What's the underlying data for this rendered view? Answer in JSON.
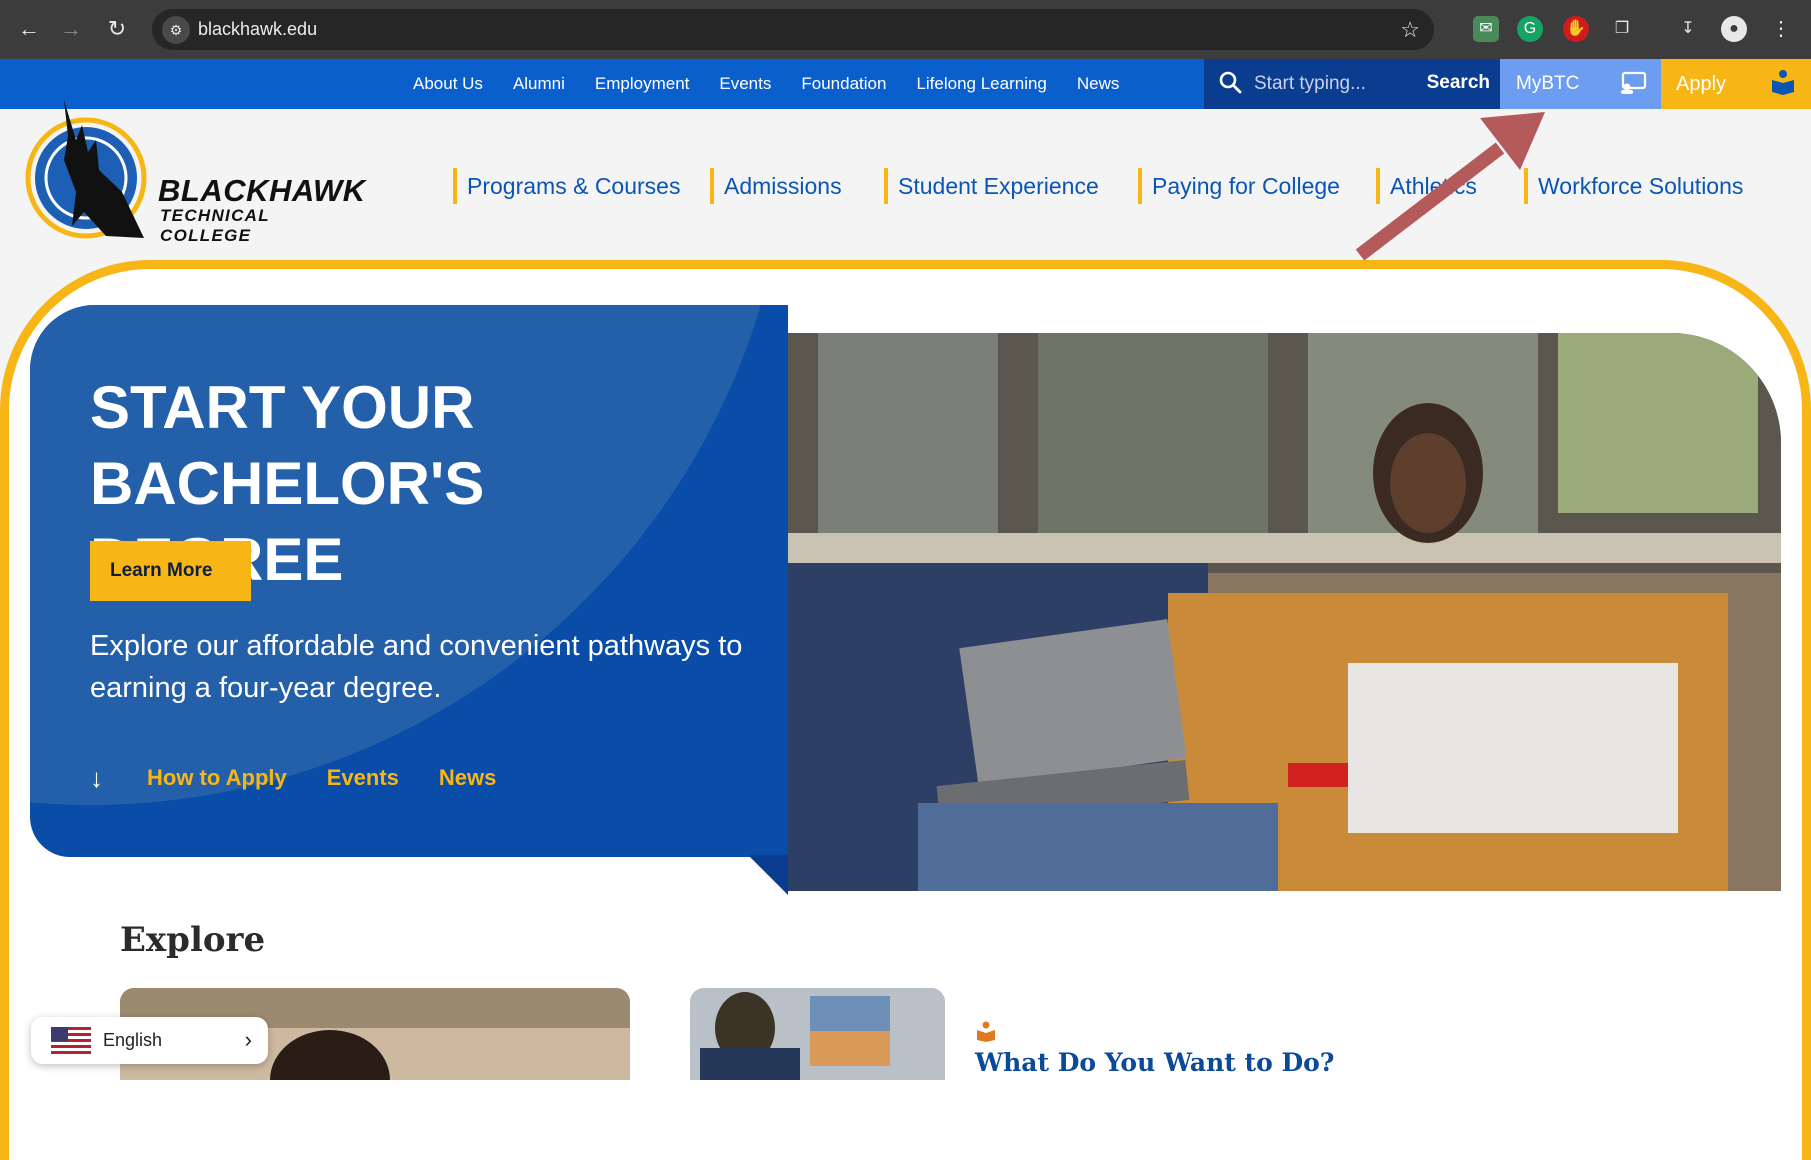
{
  "browser": {
    "url": "blackhawk.edu",
    "back_icon": "arrow-left-icon",
    "forward_icon": "arrow-right-icon",
    "reload_icon": "reload-icon",
    "bookmark_icon": "star-icon",
    "extensions": [
      "mail-extension-icon",
      "grammarly-icon",
      "adblock-icon",
      "puzzle-icon",
      "download-icon",
      "profile-icon",
      "kebab-menu-icon"
    ]
  },
  "utility_nav": {
    "links": [
      "About Us",
      "Alumni",
      "Employment",
      "Events",
      "Foundation",
      "Lifelong Learning",
      "News"
    ],
    "search_placeholder": "Start typing...",
    "search_button": "Search",
    "mybtc": "MyBTC",
    "apply": "Apply"
  },
  "logo": {
    "line1": "BLACKHAWK",
    "line2": "TECHNICAL COLLEGE"
  },
  "main_nav": [
    "Programs & Courses",
    "Admissions",
    "Student Experience",
    "Paying for College",
    "Athletics",
    "Workforce Solutions"
  ],
  "hero": {
    "title_line1": "START YOUR",
    "title_line2": "BACHELOR'S DEGREE",
    "cta": "Learn More",
    "subtitle": "Explore our affordable and convenient pathways to earning a four-year degree.",
    "links": [
      "How to Apply",
      "Events",
      "News"
    ]
  },
  "explore": {
    "heading": "Explore",
    "card_title": "What Do You Want to Do?"
  },
  "language": {
    "label": "English"
  },
  "colors": {
    "brand_blue": "#0b5fcc",
    "dark_blue": "#0a4da8",
    "gold": "#f7b616",
    "annotation_arrow": "#b55a5a"
  }
}
